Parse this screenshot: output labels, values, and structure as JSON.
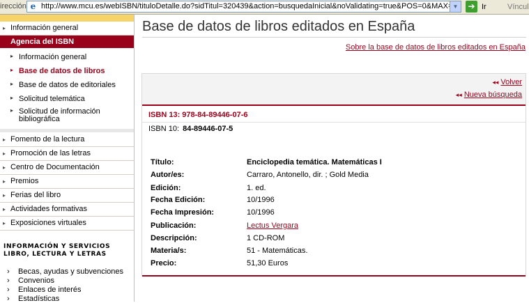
{
  "browser": {
    "address_label": "irección",
    "url": "http://www.mcu.es/webISBN/tituloDetalle.do?sidTitul=320439&action=busquedaInicial&noValidating=true&POS=0&MAX=",
    "go_label": "Ir",
    "links_label": "Vínculo"
  },
  "nav": {
    "top_item": "Información general",
    "active_header": "Agencia del ISBN",
    "sub_items": [
      "Información general",
      "Base de datos de libros",
      "Base de datos de editoriales",
      "Solicitud telemática",
      "Solicitud de información bibliográfica"
    ],
    "sections": [
      "Fomento de la lectura",
      "Promoción de las letras",
      "Centro de Documentación",
      "Premios",
      "Ferias del libro",
      "Actividades formativas",
      "Exposiciones virtuales"
    ],
    "info_heading": "INFORMACIÓN Y SERVICIOS LIBRO, LECTURA Y LETRAS",
    "info_links": [
      "Becas, ayudas y subvenciones",
      "Convenios",
      "Enlaces de interés",
      "Estadísticas"
    ]
  },
  "main": {
    "title": "Base de datos de libros editados en España",
    "about_link": "Sobre la base de datos de libros editados en España",
    "back_link": "Volver",
    "new_search_link": "Nueva búsqueda",
    "isbn13": "ISBN 13: 978-84-89446-07-6",
    "isbn10_label": "ISBN 10:",
    "isbn10_value": "84-89446-07-5",
    "fields": [
      {
        "label": "Título:",
        "value": "Enciclopedia temática. Matemáticas I"
      },
      {
        "label": "Autor/es:",
        "value": "Carraro, Antonello, dir. ; Gold Media"
      },
      {
        "label": "Edición:",
        "value": "1. ed."
      },
      {
        "label": "Fecha Edición:",
        "value": "10/1996"
      },
      {
        "label": "Fecha Impresión:",
        "value": "10/1996"
      },
      {
        "label": "Publicación:",
        "value": "Lectus Vergara"
      },
      {
        "label": "Descripción:",
        "value": "1 CD-ROM"
      },
      {
        "label": "Materia/s:",
        "value": "51 - Matemáticas."
      },
      {
        "label": "Precio:",
        "value": "51,30 Euros"
      }
    ]
  },
  "colors": {
    "brand_red": "#99001a",
    "accent_yellow": "#f7d46a"
  }
}
